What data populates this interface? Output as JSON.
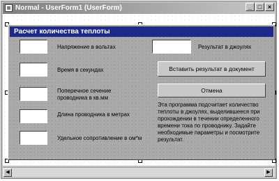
{
  "window": {
    "title": "Normal - UserForm1 (UserForm)",
    "minimize_glyph": "_",
    "maximize_glyph": "□",
    "close_glyph": "×"
  },
  "form": {
    "title": "Расчет количества теплоты",
    "inputs": [
      {
        "label": "Напряжение в вольтах",
        "value": ""
      },
      {
        "label": "Время в секундах",
        "value": ""
      },
      {
        "label": "Поперечное сечение проводника в кв.мм",
        "value": ""
      },
      {
        "label": "Длина проводника в метрах",
        "value": ""
      },
      {
        "label": "Удельное сопротивление в ом*м",
        "value": ""
      }
    ],
    "result": {
      "label": "Результат в джоулях",
      "value": ""
    },
    "insert_button": "Вставить результат в документ",
    "cancel_button": "Отмена",
    "description": "Эта программа подсчитает количество теплоты в джоулях, выделившееся при прохождении в течении определенного времени тока по проводнику. Задайте необходимые параметры и посмотрите результат."
  },
  "colors": {
    "form_title_bg": "#1e2a8a",
    "form_bg": "#aaaaaa",
    "window_bg": "#c0c0c0"
  }
}
